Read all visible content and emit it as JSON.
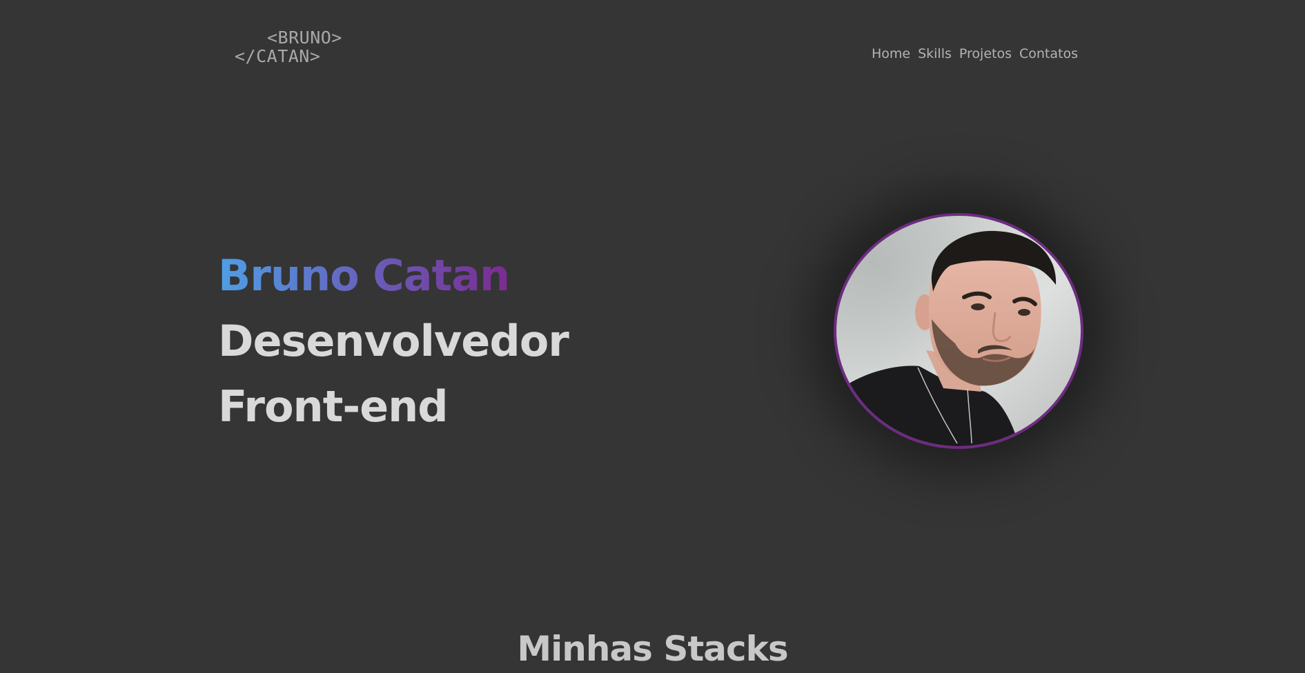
{
  "logo": {
    "line1": "<BRUNO>",
    "line2": "</CATAN>"
  },
  "nav": {
    "items": [
      {
        "label": "Home"
      },
      {
        "label": "Skills"
      },
      {
        "label": "Projetos"
      },
      {
        "label": "Contatos"
      }
    ]
  },
  "hero": {
    "name": "Bruno Catan",
    "role_line1": "Desenvolvedor",
    "role_line2": "Front-end",
    "gradient_colors": [
      "#4e9fe6",
      "#6a5bb8",
      "#7a2b8e"
    ]
  },
  "profile": {
    "border_color": "#6e2b82"
  },
  "stacks": {
    "title": "Minhas Stacks"
  },
  "colors": {
    "background": "#353535",
    "heading": "#d9d9d9",
    "nav_text": "#b4b4b4",
    "logo_text": "#a9a9a9"
  }
}
